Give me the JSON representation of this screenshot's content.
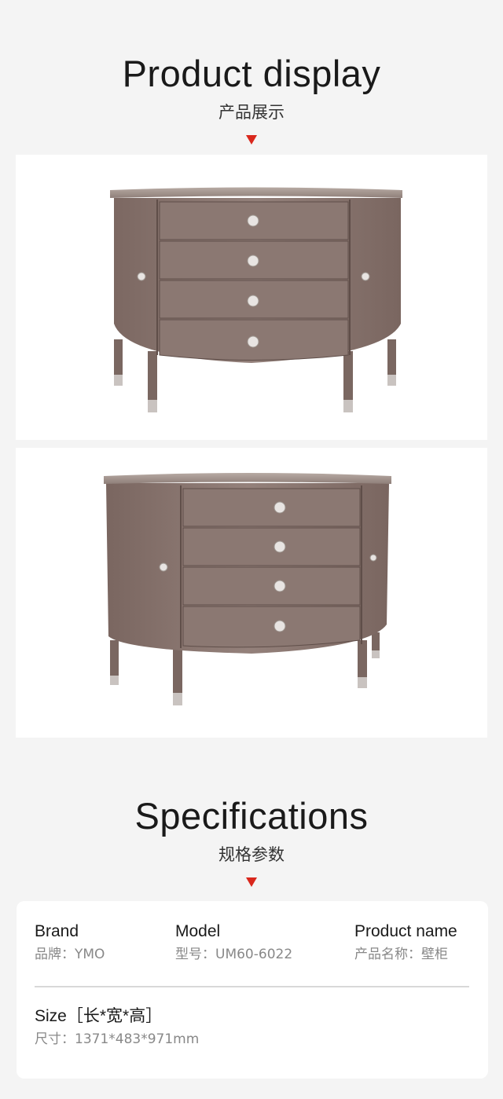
{
  "display": {
    "title_en": "Product display",
    "title_cn": "产品展示"
  },
  "photos": [
    {
      "alt": "product-photo-front"
    },
    {
      "alt": "product-photo-angle"
    }
  ],
  "specifications": {
    "title_en": "Specifications",
    "title_cn": "规格参数",
    "brand": {
      "label": "Brand",
      "value": "品牌：YMO"
    },
    "model": {
      "label": "Model",
      "value": "型号：UM60-6022"
    },
    "product_name": {
      "label": "Product name",
      "value": "产品名称：壁柜"
    },
    "size": {
      "label": "Size［长*宽*高］",
      "value": "尺寸：1371*483*971mm"
    }
  },
  "colors": {
    "background": "#f4f4f4",
    "accent_triangle": "#d9271c",
    "wood": "#8a7670"
  }
}
